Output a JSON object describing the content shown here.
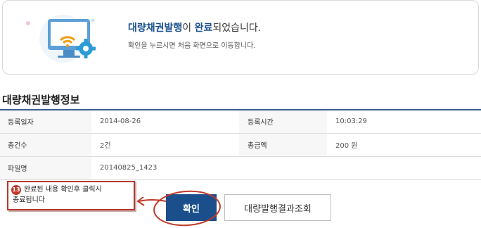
{
  "banner": {
    "title_highlight": "대량채권발행",
    "title_mid": "이 ",
    "title_bold": "완료",
    "title_end": "되었습니다.",
    "description": "확인을 누르시면 처음 화면으로 이동합니다."
  },
  "section": {
    "title": "대량채권발행정보"
  },
  "info": {
    "reg_date_label": "등록일자",
    "reg_date_value": "2014-08-26",
    "reg_time_label": "등록시간",
    "reg_time_value": "10:03:29",
    "count_label": "총건수",
    "count_value": "2건",
    "amount_label": "총금액",
    "amount_value": "200 원",
    "filename_label": "파일명",
    "filename_value": "20140825_1423"
  },
  "buttons": {
    "confirm": "확인",
    "result": "대량발행결과조회"
  },
  "annotation": {
    "number": "13",
    "line1": "완료된 내용 확인후 클릭시",
    "line2": "종료됩니다"
  },
  "colors": {
    "accent": "#1b4f8c",
    "annotation": "#c0392b"
  }
}
